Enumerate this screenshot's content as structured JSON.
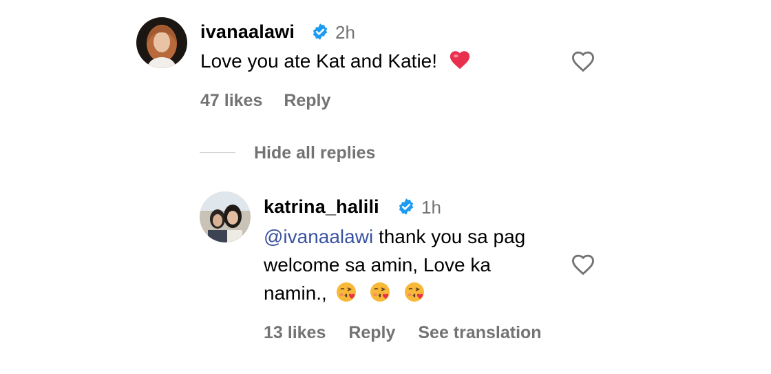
{
  "comment": {
    "username": "ivanaalawi",
    "time": "2h",
    "text": "Love you ate Kat and Katie!",
    "emoji": "red-heart",
    "likes": "47 likes",
    "reply_label": "Reply"
  },
  "replies_toggle": {
    "label": "Hide all replies"
  },
  "reply": {
    "username": "katrina_halili",
    "time": "1h",
    "mention": "@ivanaalawi",
    "text_line1": "thank you sa pag",
    "text_line2": "welcome sa amin, Love ka",
    "text_line3": "namin.,",
    "emojis": [
      "face-blowing-kiss",
      "face-blowing-kiss",
      "face-blowing-kiss"
    ],
    "likes": "13 likes",
    "reply_label": "Reply",
    "translate_label": "See translation"
  },
  "colors": {
    "verified": "#1d9bf0",
    "meta_text": "#737373",
    "mention": "#3a53a0",
    "heart": "#e8304e"
  }
}
